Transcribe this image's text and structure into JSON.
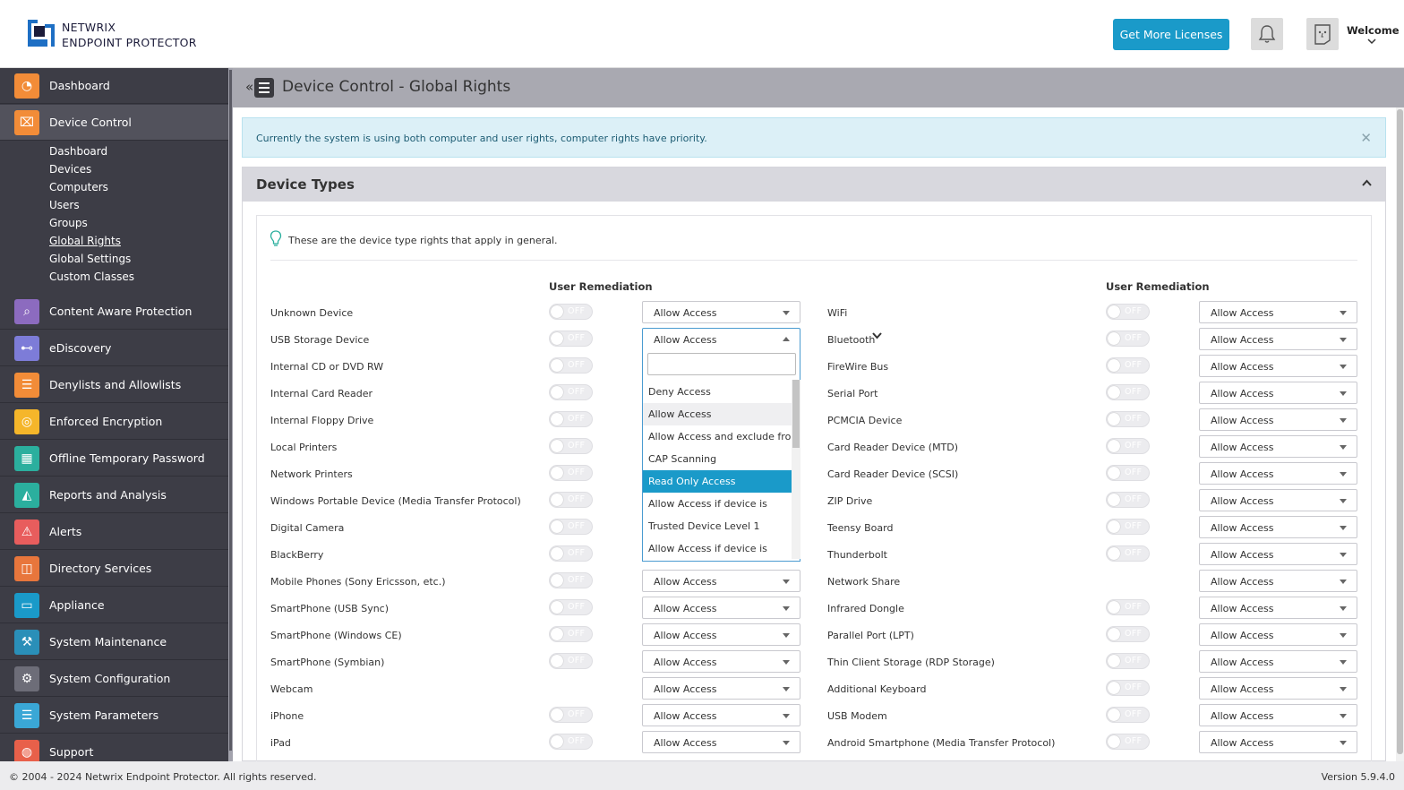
{
  "header": {
    "brand_line1": "NETWRIX",
    "brand_line2": "ENDPOINT PROTECTOR",
    "licenses_button": "Get More Licenses",
    "welcome": "Welcome"
  },
  "sidebar": {
    "items": [
      {
        "label": "Dashboard",
        "icon": "dashboard-icon",
        "color": "#f28c38"
      },
      {
        "label": "Device Control",
        "icon": "usb-icon",
        "color": "#f28c38"
      },
      {
        "label": "Content Aware Protection",
        "icon": "document-search-icon",
        "color": "#8c6bbf"
      },
      {
        "label": "eDiscovery",
        "icon": "telescope-icon",
        "color": "#7d7cd8"
      },
      {
        "label": "Denylists and Allowlists",
        "icon": "list-icon",
        "color": "#f28c38"
      },
      {
        "label": "Enforced Encryption",
        "icon": "encryption-icon",
        "color": "#f5b62a"
      },
      {
        "label": "Offline Temporary Password",
        "icon": "calculator-icon",
        "color": "#2baf9e"
      },
      {
        "label": "Reports and Analysis",
        "icon": "chart-icon",
        "color": "#2baf9e"
      },
      {
        "label": "Alerts",
        "icon": "alert-icon",
        "color": "#e85d5d"
      },
      {
        "label": "Directory Services",
        "icon": "directory-icon",
        "color": "#e8763c"
      },
      {
        "label": "Appliance",
        "icon": "appliance-icon",
        "color": "#1a9ac9"
      },
      {
        "label": "System Maintenance",
        "icon": "tools-icon",
        "color": "#2a8fb8"
      },
      {
        "label": "System Configuration",
        "icon": "gear-icon",
        "color": "#6d6d78"
      },
      {
        "label": "System Parameters",
        "icon": "parameters-icon",
        "color": "#3aa7d6"
      },
      {
        "label": "Support",
        "icon": "lifebuoy-icon",
        "color": "#e8604a"
      }
    ],
    "sub_items": [
      "Dashboard",
      "Devices",
      "Computers",
      "Users",
      "Groups",
      "Global Rights",
      "Global Settings",
      "Custom Classes"
    ]
  },
  "page": {
    "title": "Device Control - Global Rights",
    "alert": "Currently the system is using both computer and user rights, computer rights have priority.",
    "panel_title": "Device Types",
    "hint": "These are the device type rights that apply in general.",
    "col_user_remediation": "User Remediation"
  },
  "toggle_off": "OFF",
  "default_access": "Allow Access",
  "left_devices": [
    "Unknown Device",
    "USB Storage Device",
    "Internal CD or DVD RW",
    "Internal Card Reader",
    "Internal Floppy Drive",
    "Local Printers",
    "Network Printers",
    "Windows Portable Device (Media Transfer Protocol)",
    "Digital Camera",
    "BlackBerry",
    "Mobile Phones (Sony Ericsson, etc.)",
    "SmartPhone (USB Sync)",
    "SmartPhone (Windows CE)",
    "SmartPhone (Symbian)",
    "Webcam",
    "iPhone",
    "iPad"
  ],
  "right_devices": [
    "WiFi",
    "Bluetooth",
    "FireWire Bus",
    "Serial Port",
    "PCMCIA Device",
    "Card Reader Device (MTD)",
    "Card Reader Device (SCSI)",
    "ZIP Drive",
    "Teensy Board",
    "Thunderbolt",
    "Network Share",
    "Infrared Dongle",
    "Parallel Port (LPT)",
    "Thin Client Storage (RDP Storage)",
    "Additional Keyboard",
    "USB Modem",
    "Android Smartphone (Media Transfer Protocol)"
  ],
  "dropdown": {
    "search_value": "",
    "options": [
      "Deny Access",
      "Allow Access",
      "Allow Access and exclude from",
      "CAP Scanning",
      "Read Only Access",
      "Allow Access if device is",
      "Trusted Device Level 1",
      "Allow Access if device is"
    ],
    "hovered": "Allow Access",
    "selected": "Read Only Access"
  },
  "footer": {
    "copyright": "© 2004 - 2024 Netwrix Endpoint Protector. All rights reserved.",
    "version": "Version 5.9.4.0"
  }
}
